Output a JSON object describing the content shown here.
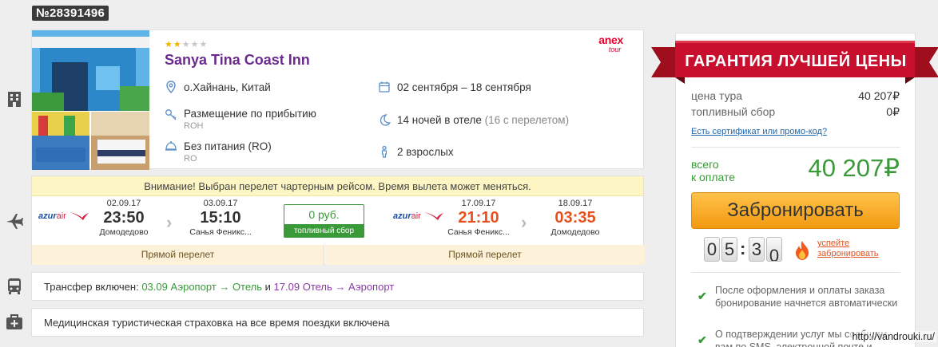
{
  "order": {
    "number": "№28391496"
  },
  "hotel": {
    "stars_filled": 2,
    "stars_total": 5,
    "name": "Sanya Tina Coast Inn",
    "operator": {
      "brand": "anex",
      "sub": "tour"
    },
    "location": "о.Хайнань, Китай",
    "room": {
      "label": "Размещение по прибытию",
      "code": "ROH"
    },
    "meal": {
      "label": "Без питания (RO)",
      "code": "RO"
    },
    "dates": "02 сентября – 18 сентября",
    "nights": {
      "main": "14 ночей в отеле",
      "extra": "(16 с перелетом)"
    },
    "guests": "2 взрослых"
  },
  "flight": {
    "notice": "Внимание! Выбран перелет чартерным рейсом. Время вылета может меняться.",
    "outbound": {
      "airline": "azur",
      "airline_suffix": "air",
      "depart": {
        "date": "02.09.17",
        "time": "23:50",
        "city": "Домодедово"
      },
      "arrive": {
        "date": "03.09.17",
        "time": "15:10",
        "city": "Санья Феникс..."
      },
      "direct": "Прямой перелет"
    },
    "fuel": {
      "value": "0 руб.",
      "label": "топливный сбор"
    },
    "inbound": {
      "airline": "azur",
      "airline_suffix": "air",
      "depart": {
        "date": "17.09.17",
        "time": "21:10",
        "city": "Санья Феникс..."
      },
      "arrive": {
        "date": "18.09.17",
        "time": "03:35",
        "city": "Домодедово"
      },
      "direct": "Прямой перелет"
    }
  },
  "transfer": {
    "prefix": "Трансфер включен: ",
    "out_date": "03.09",
    "out_route": "Аэропорт → Отель",
    "and": " и ",
    "back_date": "17.09",
    "back_route": "Отель → Аэропорт"
  },
  "insurance": {
    "text": "Медицинская туристическая страховка на все время поездки включена"
  },
  "price": {
    "guarantee": "ГАРАНТИЯ ЛУЧШЕЙ ЦЕНЫ",
    "tour_label": "цена тура",
    "tour_value": "40 207₽",
    "fuel_label": "топливный сбор",
    "fuel_value": "0₽",
    "promo_link": "Есть сертификат или промо-код?",
    "total_label_1": "всего",
    "total_label_2": "к оплате",
    "total_value": "40 207₽",
    "book_button": "Забронировать",
    "timer": [
      "0",
      "5",
      "3",
      "0"
    ],
    "hurry_1": "успейте",
    "hurry_2": "забронировать",
    "notes": [
      "После оформления и оплаты заказа бронирование начнется автоматически",
      "О подтверждении услуг мы сообщим вам по SMS, электронной почте и"
    ]
  },
  "watermark": "http://vandrouki.ru/",
  "colors": {
    "purple": "#6a2a8e",
    "green": "#3a9a3a",
    "orange": "#f29a10",
    "red": "#c8102e"
  }
}
